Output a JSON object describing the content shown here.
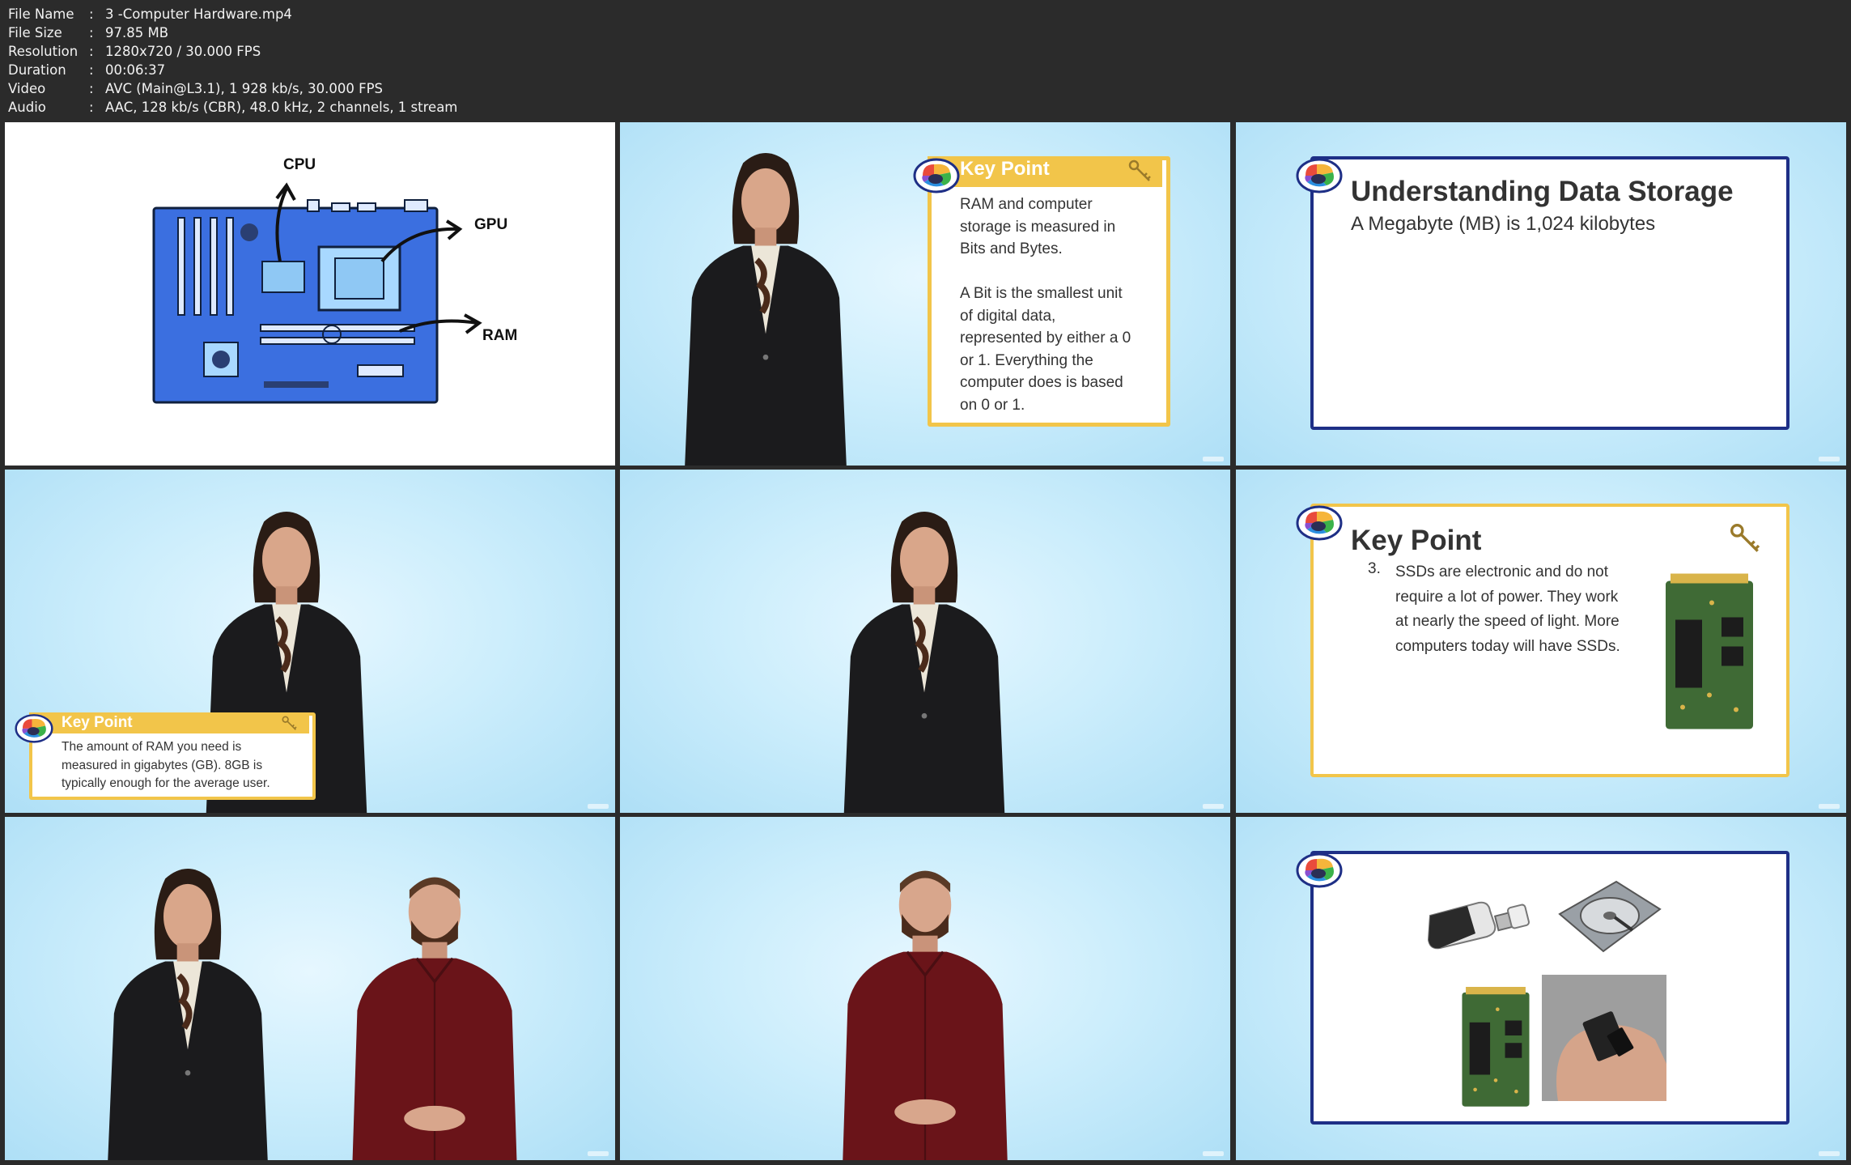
{
  "file_info": [
    {
      "key": "File Name",
      "value": "3 -Computer Hardware.mp4"
    },
    {
      "key": "File Size",
      "value": "97.85 MB"
    },
    {
      "key": "Resolution",
      "value": "1280x720 / 30.000 FPS"
    },
    {
      "key": "Duration",
      "value": "00:06:37"
    },
    {
      "key": "Video",
      "value": "AVC (Main@L3.1), 1 928 kb/s, 30.000 FPS"
    },
    {
      "key": "Audio",
      "value": "AAC, 128 kb/s (CBR), 48.0 kHz, 2 channels, 1 stream"
    }
  ],
  "separator": ":",
  "frames": {
    "f1": {
      "labels": {
        "cpu": "CPU",
        "gpu": "GPU",
        "ram": "RAM"
      }
    },
    "f2": {
      "heading": "Key Point",
      "lines": [
        "RAM and computer",
        "storage is measured in",
        "Bits and Bytes.",
        "",
        "A Bit is the smallest unit",
        "of digital data,",
        "represented by either a 0",
        "or 1. Everything the",
        "computer does is based",
        "on 0 or 1."
      ]
    },
    "f3": {
      "title": "Understanding Data Storage",
      "subtitle": "A Megabyte (MB) is 1,024 kilobytes"
    },
    "f4": {
      "heading": "Key Point",
      "lines": [
        "The amount of RAM you need is",
        "measured in gigabytes (GB). 8GB is",
        "typically enough for the average user."
      ]
    },
    "f6": {
      "title": "Key Point",
      "number": "3.",
      "lines": [
        "SSDs are electronic and do not",
        "require a lot of power. They work",
        "at nearly the speed of light. More",
        "computers today will have SSDs."
      ]
    }
  },
  "colors": {
    "sky": "#cdeefc",
    "gold": "#f2c54a",
    "navy": "#1e2f86",
    "board": "#3b6fe0",
    "jacket": "#1b1b1d",
    "maroon": "#6a1419"
  }
}
